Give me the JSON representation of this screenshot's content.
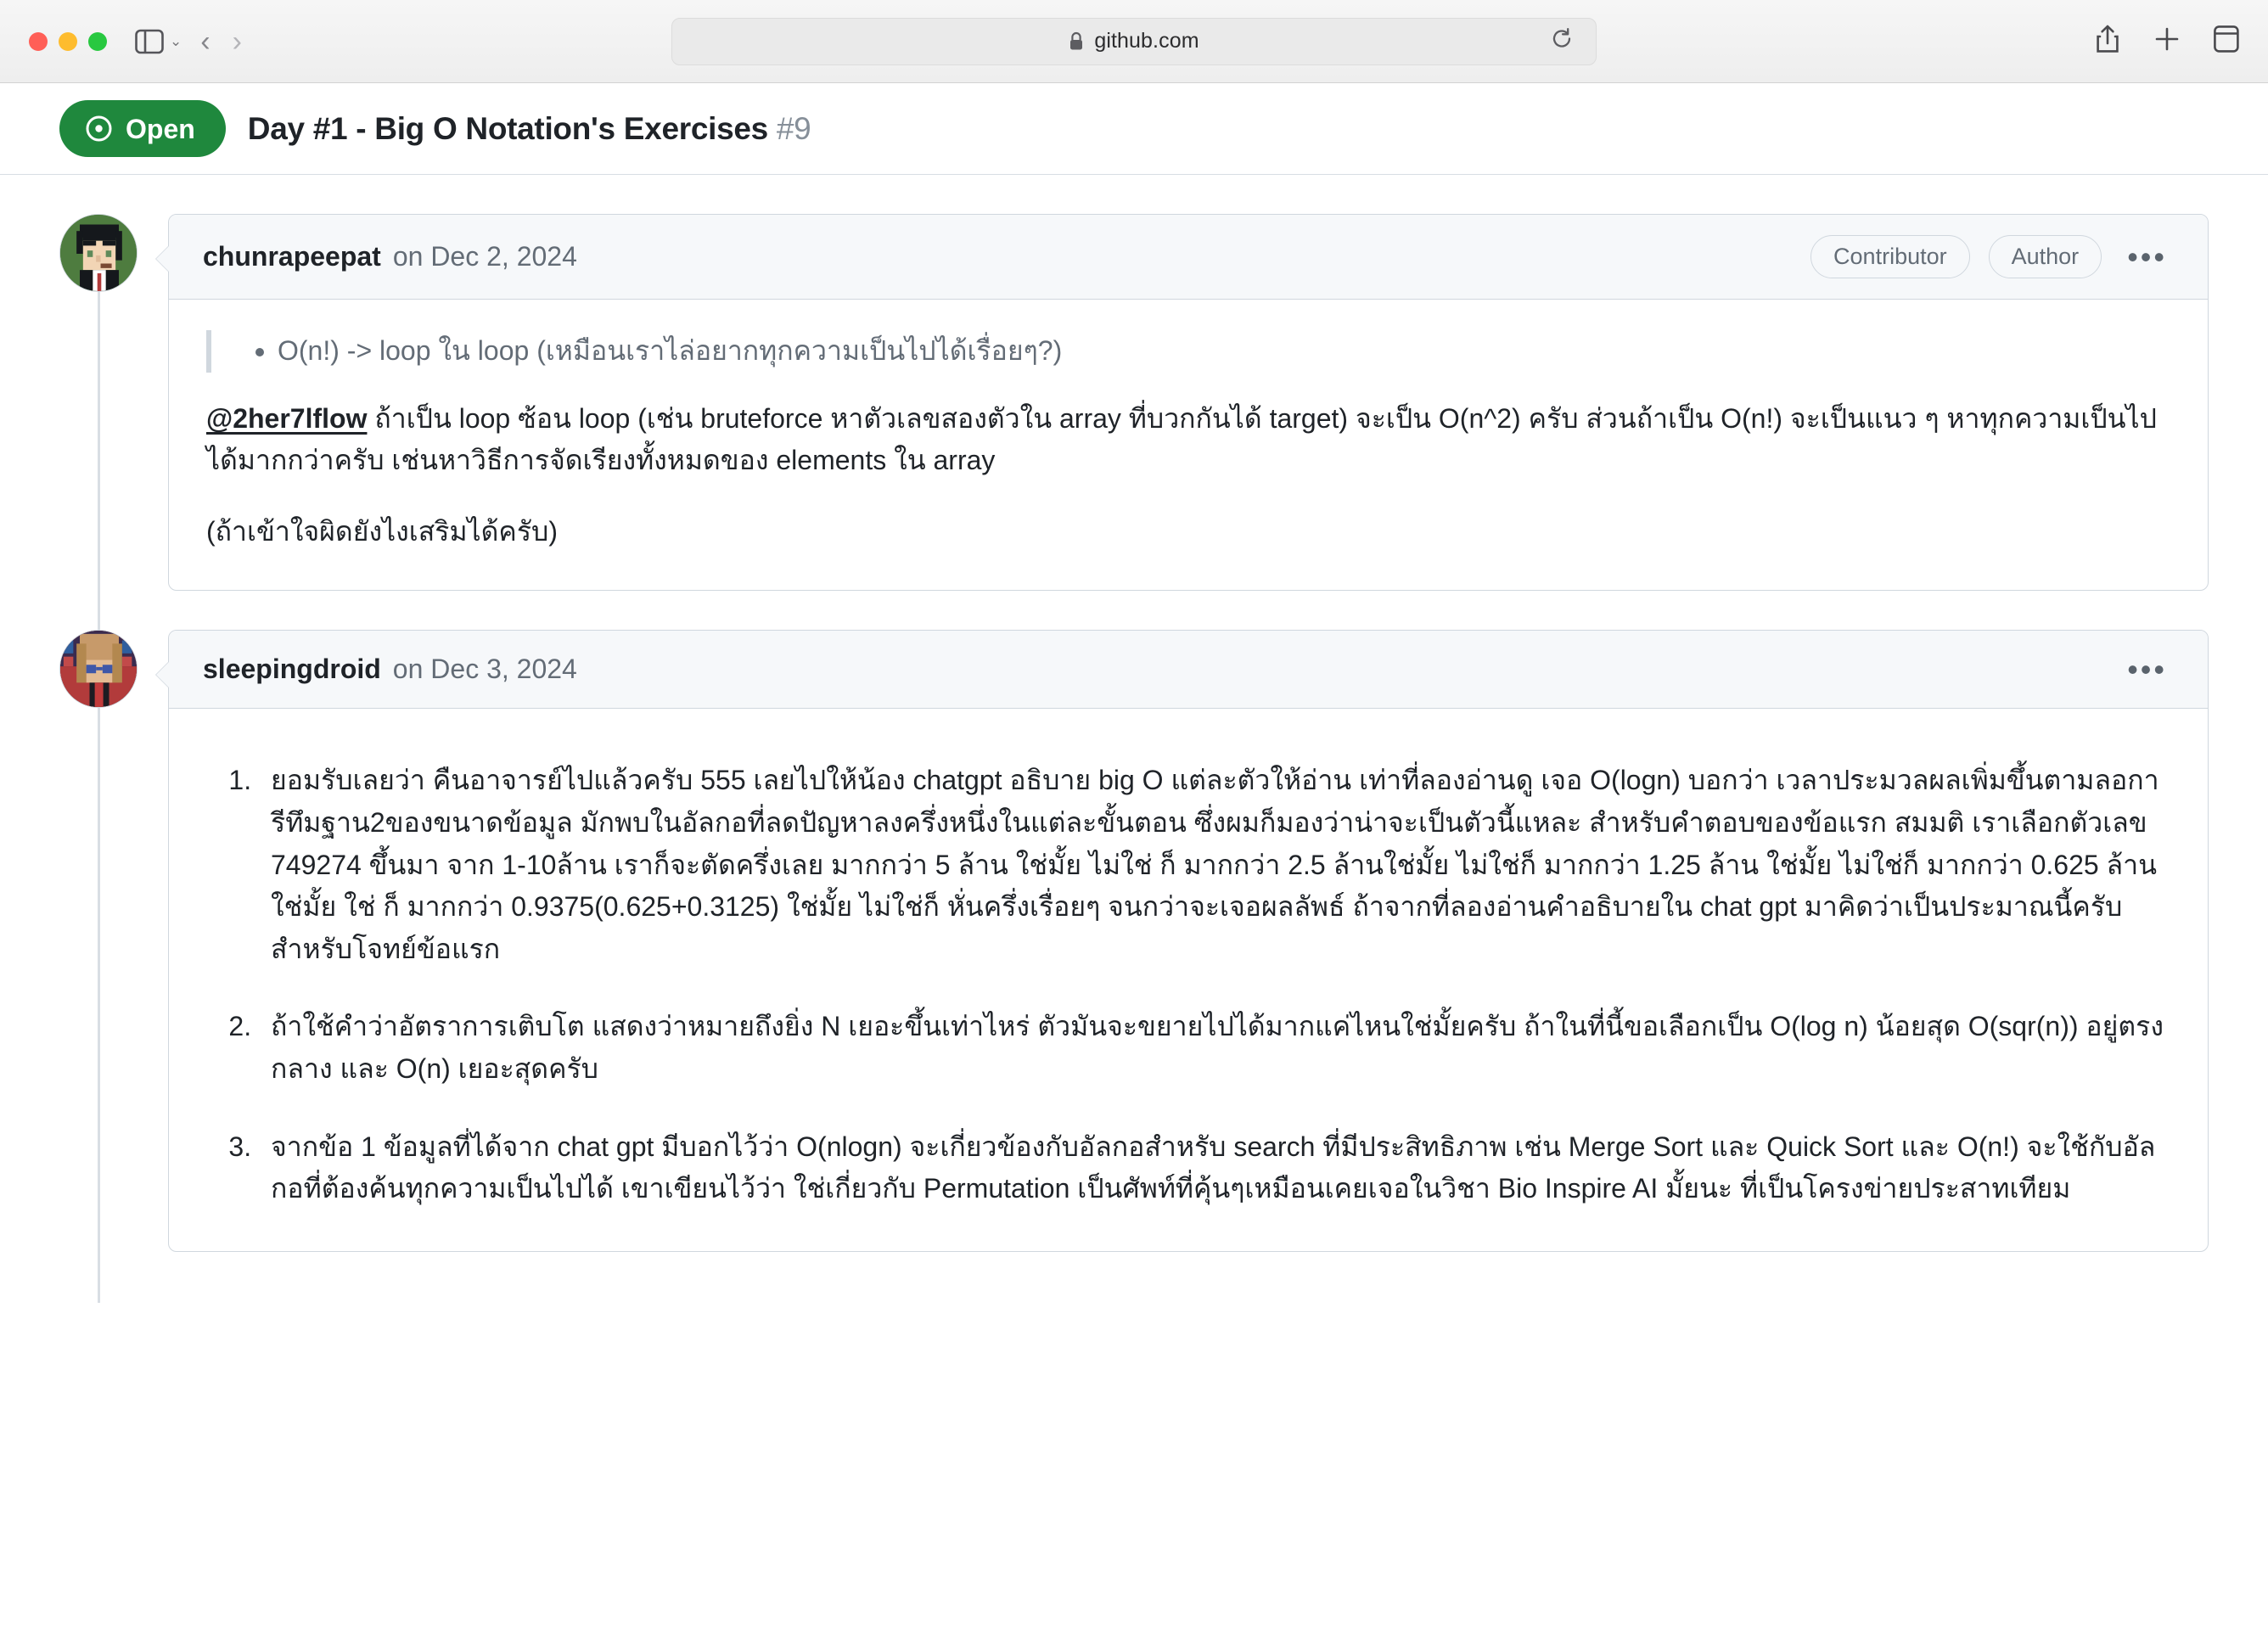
{
  "browser": {
    "url": "github.com",
    "lock_icon": "lock-icon",
    "reload_icon": "reload-icon",
    "back_icon": "chevron-left-icon",
    "forward_icon": "chevron-right-icon",
    "sidebar_icon": "sidebar-toggle-icon",
    "sidebar_chevron": "chevron-down-icon",
    "share_icon": "share-icon",
    "new_tab_icon": "plus-icon",
    "tabs_icon": "tab-overview-icon",
    "traffic_lights": {
      "close": "#ff5f57",
      "minimize": "#febc2e",
      "maximize": "#28c840"
    }
  },
  "issue": {
    "state_label": "Open",
    "state_icon": "issue-opened-icon",
    "state_color": "#1f883d",
    "title": "Day #1 - Big O Notation's Exercises",
    "number": "#9"
  },
  "comments": [
    {
      "author": "chunrapeepat",
      "date": "on Dec 2, 2024",
      "badges": [
        "Contributor",
        "Author"
      ],
      "menu_icon": "kebab-menu-icon",
      "quote": "O(n!) -> loop ใน loop (เหมือนเราไล่อยากทุกความเป็นไปได้เรื่อยๆ?)",
      "mention": "@2her7lflow",
      "body_after_mention": " ถ้าเป็น loop ซ้อน loop (เช่น bruteforce หาตัวเลขสองตัวใน array ที่บวกกันได้ target) จะเป็น O(n^2) ครับ ส่วนถ้าเป็น O(n!) จะเป็นแนว ๆ หาทุกความเป็นไปได้มากกว่าครับ เช่นหาวิธีการจัดเรียงทั้งหมดของ elements ใน array",
      "closing": "(ถ้าเข้าใจผิดยังไงเสริมได้ครับ)"
    },
    {
      "author": "sleepingdroid",
      "date": "on Dec 3, 2024",
      "badges": [],
      "menu_icon": "kebab-menu-icon",
      "list": [
        "ยอมรับเลยว่า คืนอาจารย์ไปแล้วครับ 555 เลยไปให้น้อง chatgpt อธิบาย big O แต่ละตัวให้อ่าน เท่าที่ลองอ่านดู เจอ O(logn) บอกว่า เวลาประมวลผลเพิ่มขึ้นตามลอการีทึมฐาน2ของขนาดข้อมูล มักพบในอัลกอที่ลดปัญหาลงครึ่งหนึ่งในแต่ละขั้นตอน ซึ่งผมก็มองว่าน่าจะเป็นตัวนี้แหละ สำหรับคำตอบของข้อแรก สมมติ เราเลือกตัวเลข 749274 ขึ้นมา จาก 1-10ล้าน เราก็จะตัดครึ่งเลย มากกว่า 5 ล้าน ใช่มั้ย ไม่ใช่ ก็ มากกว่า 2.5 ล้านใช่มั้ย ไม่ใช่ก็ มากกว่า 1.25 ล้าน ใช่มั้ย ไม่ใช่ก็ มากกว่า 0.625 ล้านใช่มั้ย ใช่ ก็ มากกว่า 0.9375(0.625+0.3125) ใช่มั้ย ไม่ใช่ก็ หั่นครึ่งเรื่อยๆ จนกว่าจะเจอผลลัพธ์ ถ้าจากที่ลองอ่านคำอธิบายใน chat gpt มาคิดว่าเป็นประมาณนี้ครับ สำหรับโจทย์ข้อแรก",
        "ถ้าใช้คำว่าอัตราการเติบโต แสดงว่าหมายถึงยิ่ง N เยอะขึ้นเท่าไหร่ ตัวมันจะขยายไปได้มากแค่ไหนใช่มั้ยครับ ถ้าในที่นี้ขอเลือกเป็น O(log n) น้อยสุด O(sqr(n)) อยู่ตรงกลาง และ O(n) เยอะสุดครับ",
        "จากข้อ 1 ข้อมูลที่ได้จาก chat gpt มีบอกไว้ว่า O(nlogn) จะเกี่ยวข้องกับอัลกอสำหรับ search ที่มีประสิทธิภาพ เช่น Merge Sort และ Quick Sort และ O(n!) จะใช้กับอัลกอที่ต้องค้นทุกความเป็นไปได้ เขาเขียนไว้ว่า ใช่เกี่ยวกับ Permutation เป็นศัพท์ที่คุ้นๆเหมือนเคยเจอในวิชา Bio Inspire AI มั้ยนะ ที่เป็นโครงข่ายประสาทเทียม"
      ]
    }
  ]
}
